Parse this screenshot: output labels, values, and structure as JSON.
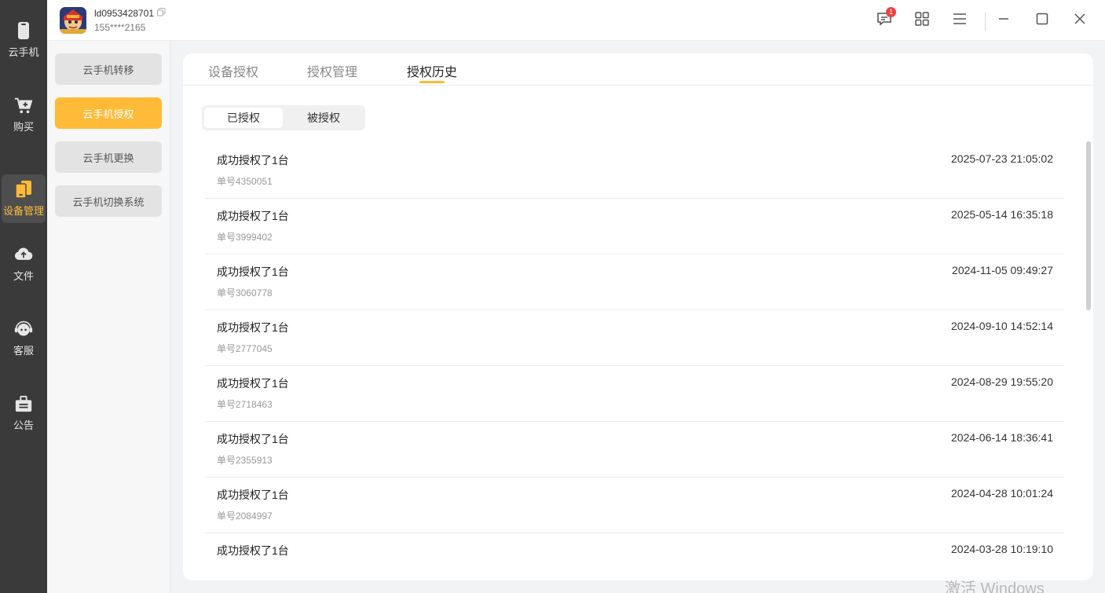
{
  "rail": {
    "items": [
      {
        "label": "云手机",
        "icon": "phone-icon"
      },
      {
        "label": "购买",
        "icon": "cart-icon"
      },
      {
        "label": "设备管理",
        "icon": "devices-icon",
        "active": true
      },
      {
        "label": "文件",
        "icon": "cloud-upload-icon"
      },
      {
        "label": "客服",
        "icon": "support-icon"
      },
      {
        "label": "公告",
        "icon": "notice-icon"
      }
    ]
  },
  "header": {
    "user_id": "ld0953428701",
    "phone": "155****2165",
    "notification_count": "1"
  },
  "submenu": {
    "items": [
      {
        "label": "云手机转移"
      },
      {
        "label": "云手机授权",
        "active": true
      },
      {
        "label": "云手机更换"
      },
      {
        "label": "云手机切换系统"
      }
    ]
  },
  "tabs": [
    {
      "label": "设备授权"
    },
    {
      "label": "授权管理"
    },
    {
      "label": "授权历史",
      "active": true
    }
  ],
  "segment": {
    "options": [
      {
        "label": "已授权",
        "active": true
      },
      {
        "label": "被授权"
      }
    ]
  },
  "records": [
    {
      "title": "成功授权了1台",
      "order": "单号4350051",
      "time": "2025-07-23 21:05:02"
    },
    {
      "title": "成功授权了1台",
      "order": "单号3999402",
      "time": "2025-05-14 16:35:18"
    },
    {
      "title": "成功授权了1台",
      "order": "单号3060778",
      "time": "2024-11-05 09:49:27"
    },
    {
      "title": "成功授权了1台",
      "order": "单号2777045",
      "time": "2024-09-10 14:52:14"
    },
    {
      "title": "成功授权了1台",
      "order": "单号2718463",
      "time": "2024-08-29 19:55:20"
    },
    {
      "title": "成功授权了1台",
      "order": "单号2355913",
      "time": "2024-06-14 18:36:41"
    },
    {
      "title": "成功授权了1台",
      "order": "单号2084997",
      "time": "2024-04-28 10:01:24"
    },
    {
      "title": "成功授权了1台",
      "order": "",
      "time": "2024-03-28 10:19:10"
    }
  ],
  "watermark": "激活 Windows",
  "colors": {
    "accent": "#ffbb38",
    "rail_bg": "#3a3a3a",
    "badge": "#f04040"
  }
}
